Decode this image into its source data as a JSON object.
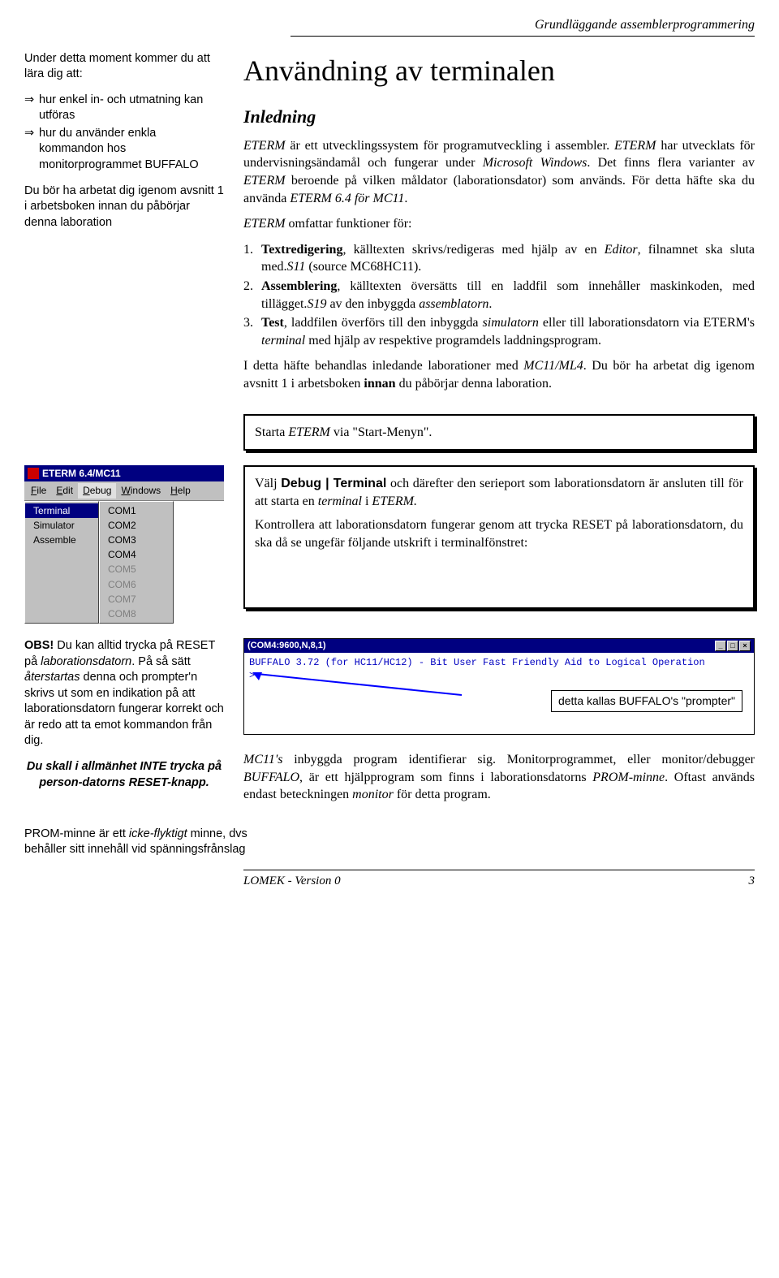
{
  "header": {
    "running_title": "Grundläggande assemblerprogrammering"
  },
  "sidebar": {
    "intro": "Under detta moment kommer du att lära dig att:",
    "bullets": [
      "hur enkel in- och utmatning kan utföras",
      "hur du använder enkla kommandon hos monitorprogrammet BUFFALO"
    ],
    "note": "Du bör ha arbetat dig igenom avsnitt 1 i arbetsboken innan du påbörjar denna laboration"
  },
  "main": {
    "title": "Användning av terminalen",
    "subhead": "Inledning",
    "p1a": "ETERM",
    "p1b": " är ett utvecklingssystem för programutveckling i assembler. ",
    "p1c": "ETERM",
    "p1d": " har utvecklats för undervisningsändamål och fungerar under ",
    "p1e": "Microsoft Windows",
    "p1f": ". Det finns flera varianter av ",
    "p1g": "ETERM",
    "p1h": " beroende på vilken måldator (laborationsdator) som används. För detta häfte ska du använda ",
    "p1i": "ETERM 6.4 för MC11",
    "p1j": ".",
    "p2a": "ETERM",
    "p2b": " omfattar funktioner för:",
    "list": [
      {
        "n": "1.",
        "a": "Textredigering",
        "b": ", källtexten skrivs/redigeras med hjälp av en ",
        "c": "Editor",
        "d": ", filnamnet ska sluta med.",
        "e": "S11",
        "f": " (source MC68HC11)."
      },
      {
        "n": "2.",
        "a": "Assemblering",
        "b": ", källtexten översätts till en laddfil som innehåller maskinkoden, med tillägget.",
        "c": "S19",
        "d": " av den inbyggda ",
        "e": "assemblatorn",
        "f": "."
      },
      {
        "n": "3.",
        "a": "Test",
        "b": ", laddfilen överförs till den inbyggda ",
        "c": "simulatorn",
        "d": " eller till laborationsdatorn via ETERM's ",
        "e": "terminal",
        "f": " med hjälp av respektive programdels laddningsprogram."
      }
    ],
    "p3a": "I detta häfte behandlas inledande laborationer med ",
    "p3b": "MC11/ML4",
    "p3c": ". Du bör ha arbetat dig igenom avsnitt 1 i arbetsboken ",
    "p3d": "innan",
    "p3e": " du påbörjar denna laboration."
  },
  "box1": {
    "a": "Starta ",
    "b": "ETERM",
    "c": " via \"Start-Menyn\"."
  },
  "menushot": {
    "title": "ETERM 6.4/MC11",
    "menus": [
      "File",
      "Edit",
      "Debug",
      "Windows",
      "Help"
    ],
    "col1": [
      "Terminal",
      "Simulator",
      "Assemble"
    ],
    "col2": [
      "COM1",
      "COM2",
      "COM3",
      "COM4",
      "COM5",
      "COM6",
      "COM7",
      "COM8"
    ]
  },
  "box2": {
    "p1a": "Välj ",
    "p1b": "Debug | Terminal",
    "p1c": " och därefter den serieport som laborationsdatorn är ansluten till för att starta en ",
    "p1d": "terminal",
    "p1e": " i ",
    "p1f": "ETERM.",
    "p2": "Kontrollera att laborationsdatorn fungerar genom att trycka RESET på laborationsdatorn, du ska då se ungefär följande utskrift i terminalfönstret:"
  },
  "obs": {
    "p1a": "OBS!",
    "p1b": " Du kan alltid trycka på RESET på ",
    "p1c": "laborationsdatorn",
    "p1d": ". På så sätt ",
    "p1e": "återstartas",
    "p1f": " denna och prompter'n skrivs ut som en indikation på att laborationsdatorn fungerar korrekt och är redo att ta emot kommandon från dig.",
    "p2": "Du skall i allmänhet INTE trycka på person-datorns RESET-knapp.",
    "p3a": "PROM-minne är ett ",
    "p3b": "icke-flyktigt",
    "p3c": " minne, dvs behåller sitt innehåll vid spänningsfrånslag"
  },
  "terminal": {
    "title": "(COM4:9600,N,8,1)",
    "line": "BUFFALO 3.72 (for HC11/HC12) - Bit User Fast Friendly Aid to Logical Operation",
    "prompt": ">",
    "callout": "detta kallas BUFFALO's \"prompter\""
  },
  "bottom": {
    "p1a": "MC11's",
    "p1b": " inbyggda program identifierar sig. Monitorprogrammet, eller monitor/debugger ",
    "p1c": "BUFFALO",
    "p1d": ", är ett hjälpprogram som finns i laborationsdatorns ",
    "p1e": "PROM-minne",
    "p1f": ". Oftast används endast beteckningen ",
    "p1g": "monitor",
    "p1h": " för detta program."
  },
  "footer": {
    "left": "LOMEK - Version 0",
    "right": "3"
  }
}
